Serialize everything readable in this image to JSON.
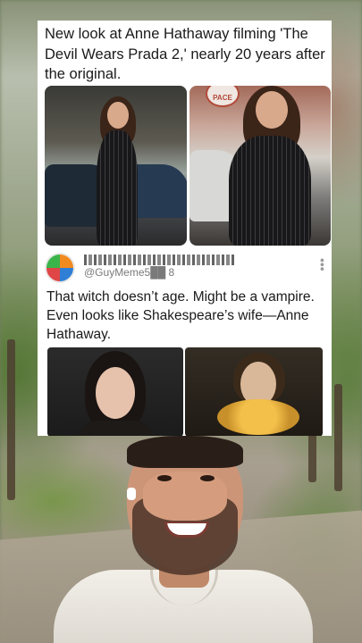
{
  "post": {
    "headline": "New look at Anne Hathaway filming 'The Devil Wears Prada 2,' nearly 20 years after the original.",
    "photo1_alt": "",
    "photo2_sign": "PACE"
  },
  "reply": {
    "handle": "@GuyMeme5██ 8",
    "text": "That witch doesn’t age. Might be a vampire. Even looks like Shakespeare’s wife—Anne Hathaway.",
    "more_glyph": "•••"
  },
  "colors": {
    "card_bg": "#ffffff",
    "text": "#1a1a1a",
    "handle": "#7a7a7a"
  },
  "icons": {
    "avatar": "colorful-logo-avatar",
    "more": "more-options-icon"
  }
}
